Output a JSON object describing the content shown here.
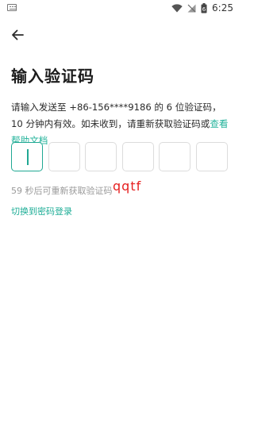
{
  "status_bar": {
    "time": "6:25",
    "battery_level": "6"
  },
  "header": {
    "back_icon": "arrow-left-icon"
  },
  "title": "输入验证码",
  "description": {
    "text": "请输入发送至 +86-156****9186 的 6 位验证码，10 分钟内有效。如未收到，请重新获取验证码或",
    "help_link": "查看帮助文档"
  },
  "code_input": {
    "length": 6,
    "values": [
      "",
      "",
      "",
      "",
      "",
      ""
    ],
    "active_index": 0,
    "accent_color": "#20a893"
  },
  "countdown_text": "59 秒后可重新获取验证码",
  "annotation": "qqtf",
  "switch_login_label": "切换到密码登录"
}
